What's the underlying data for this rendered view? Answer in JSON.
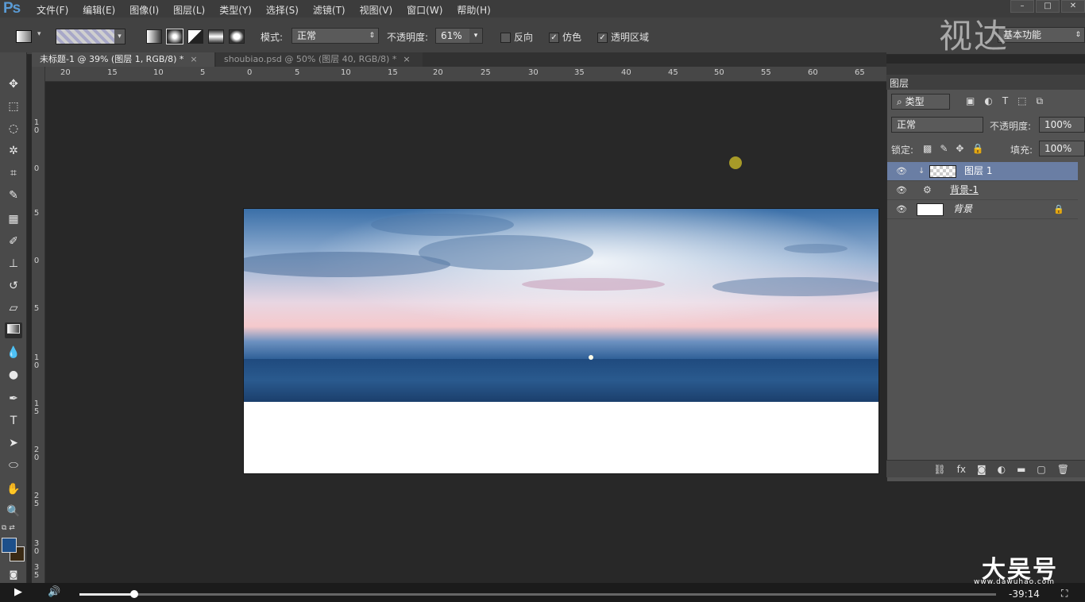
{
  "app": {
    "logo": "Ps"
  },
  "menu": [
    "文件(F)",
    "编辑(E)",
    "图像(I)",
    "图层(L)",
    "类型(Y)",
    "选择(S)",
    "滤镜(T)",
    "视图(V)",
    "窗口(W)",
    "帮助(H)"
  ],
  "watermark": {
    "top": "视达",
    "bottom": "大吴号",
    "bottom_url": "www.dawuhao.com"
  },
  "options": {
    "mode_label": "模式:",
    "mode_value": "正常",
    "opacity_label": "不透明度:",
    "opacity_value": "61%",
    "reverse_label": "反向",
    "dither_label": "仿色",
    "transparency_label": "透明区域",
    "reverse_checked": false,
    "dither_checked": true,
    "transparency_checked": true,
    "workspace": "基本功能"
  },
  "tabs": [
    {
      "label": "未标题-1 @ 39% (图层 1, RGB/8) *",
      "close": "×"
    },
    {
      "label": "shoubiao.psd @ 50% (图层 40, RGB/8) *",
      "close": "×"
    }
  ],
  "rulers": {
    "h": [
      "20",
      "15",
      "10",
      "5",
      "0",
      "5",
      "10",
      "15",
      "20",
      "25",
      "30",
      "35",
      "40",
      "45",
      "50",
      "55",
      "60",
      "65"
    ],
    "v": [
      "1\n0",
      "0",
      "5",
      "0",
      "5",
      "1\n0",
      "1\n5",
      "2\n0",
      "2\n5",
      "3\n0",
      "3\n5"
    ]
  },
  "layers_panel": {
    "title": "图层",
    "filter_label": "类型",
    "blend_mode": "正常",
    "opacity_label": "不透明度:",
    "opacity_value": "100%",
    "lock_label": "锁定:",
    "fill_label": "填充:",
    "fill_value": "100%",
    "layers": [
      {
        "name": "图层 1",
        "selected": true
      },
      {
        "name": "背景-1",
        "selected": false
      },
      {
        "name": "背景",
        "selected": false,
        "locked": true
      }
    ]
  },
  "player": {
    "time": "-39:14",
    "progress": 0.06
  },
  "colors": {
    "foreground": "#1d4f8a",
    "background": "#3a2a14",
    "selection": "#6a7ea4"
  }
}
